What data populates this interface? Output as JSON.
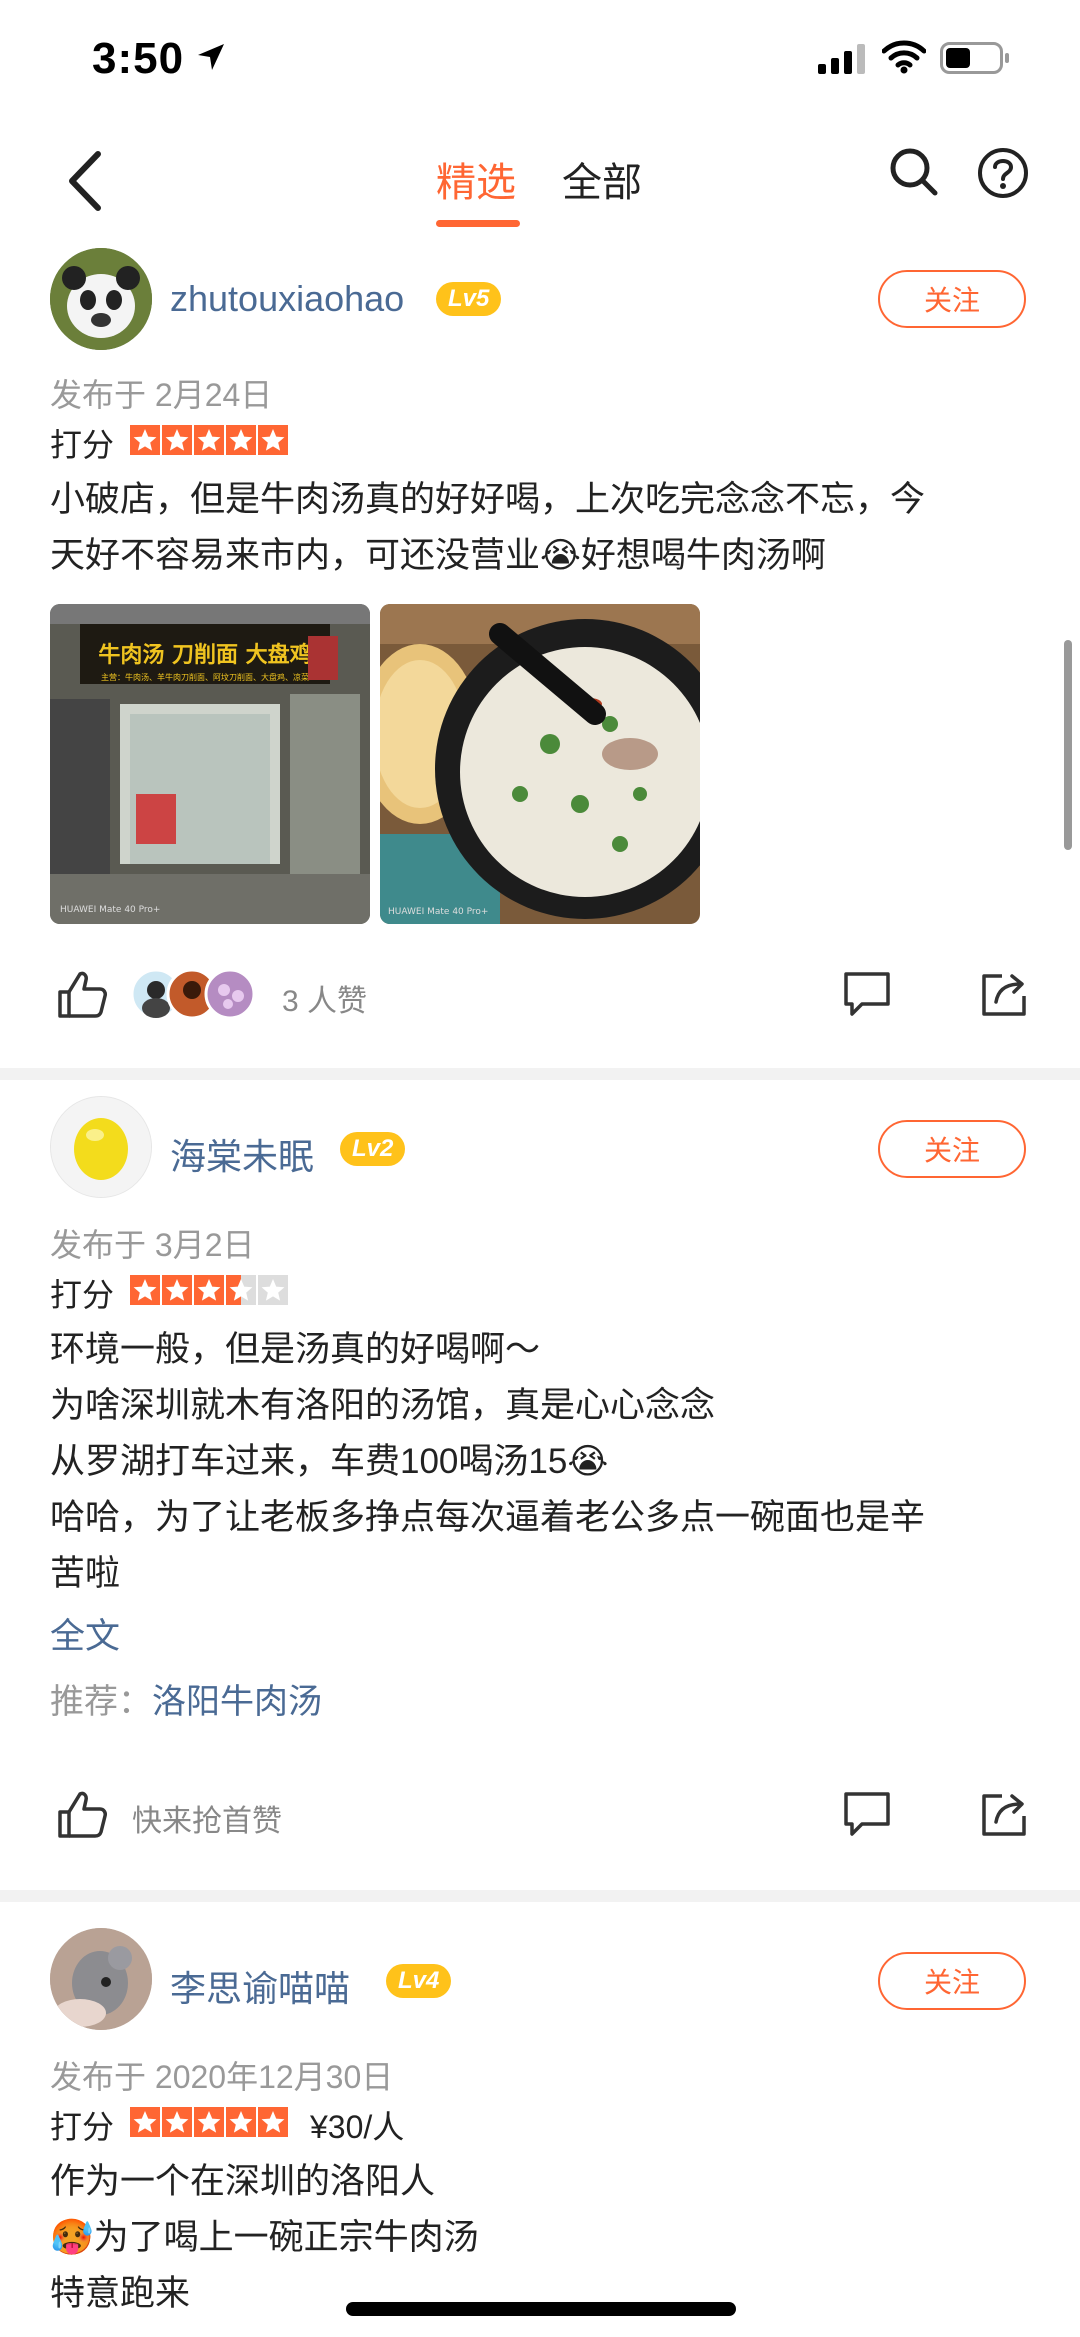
{
  "status_bar": {
    "time": "3:50"
  },
  "nav": {
    "tab_selected": "精选",
    "tab_all": "全部"
  },
  "reviews": [
    {
      "username": "zhutouxiaohao",
      "level": "Lv5",
      "follow_label": "关注",
      "date": "发布于 2月24日",
      "score_label": "打分",
      "rating": 5,
      "text_lines": [
        "小破店，但是牛肉汤真的好好喝，上次吃完念念不忘，今",
        "天好不容易来市内，可还没营业😭好想喝牛肉汤啊"
      ],
      "photo1_sign": "牛肉汤 刀削面 大盘鸡",
      "photo1_sub": "主营：牛肉汤、羊牛肉刀削面、阿坟刀削面、大盘鸡、凉菜",
      "photo_caption": "HUAWEI Mate 40 Pro+",
      "likes_text": "3 人赞"
    },
    {
      "username": "海棠未眠",
      "level": "Lv2",
      "follow_label": "关注",
      "date": "发布于 3月2日",
      "score_label": "打分",
      "rating": 3.5,
      "text_lines": [
        "环境一般，但是汤真的好喝啊～",
        "为啥深圳就木有洛阳的汤馆，真是心心念念",
        "从罗湖打车过来，车费100喝汤15😭",
        "哈哈，为了让老板多挣点每次逼着老公多点一碗面也是辛",
        "苦啦"
      ],
      "more_label": "全文",
      "rec_label": "推荐：",
      "rec_value": "洛阳牛肉汤",
      "likes_text": "快来抢首赞"
    },
    {
      "username": "李思谕喵喵",
      "level": "Lv4",
      "follow_label": "关注",
      "date": "发布于 2020年12月30日",
      "score_label": "打分",
      "rating": 5,
      "price": "¥30/人",
      "text_lines": [
        "作为一个在深圳的洛阳人",
        "🥵为了喝上一碗正宗牛肉汤",
        "特意跑来"
      ]
    }
  ],
  "colors": {
    "accent": "#ff6633",
    "link": "#4a6a94",
    "level_badge": "#ffc21a"
  }
}
